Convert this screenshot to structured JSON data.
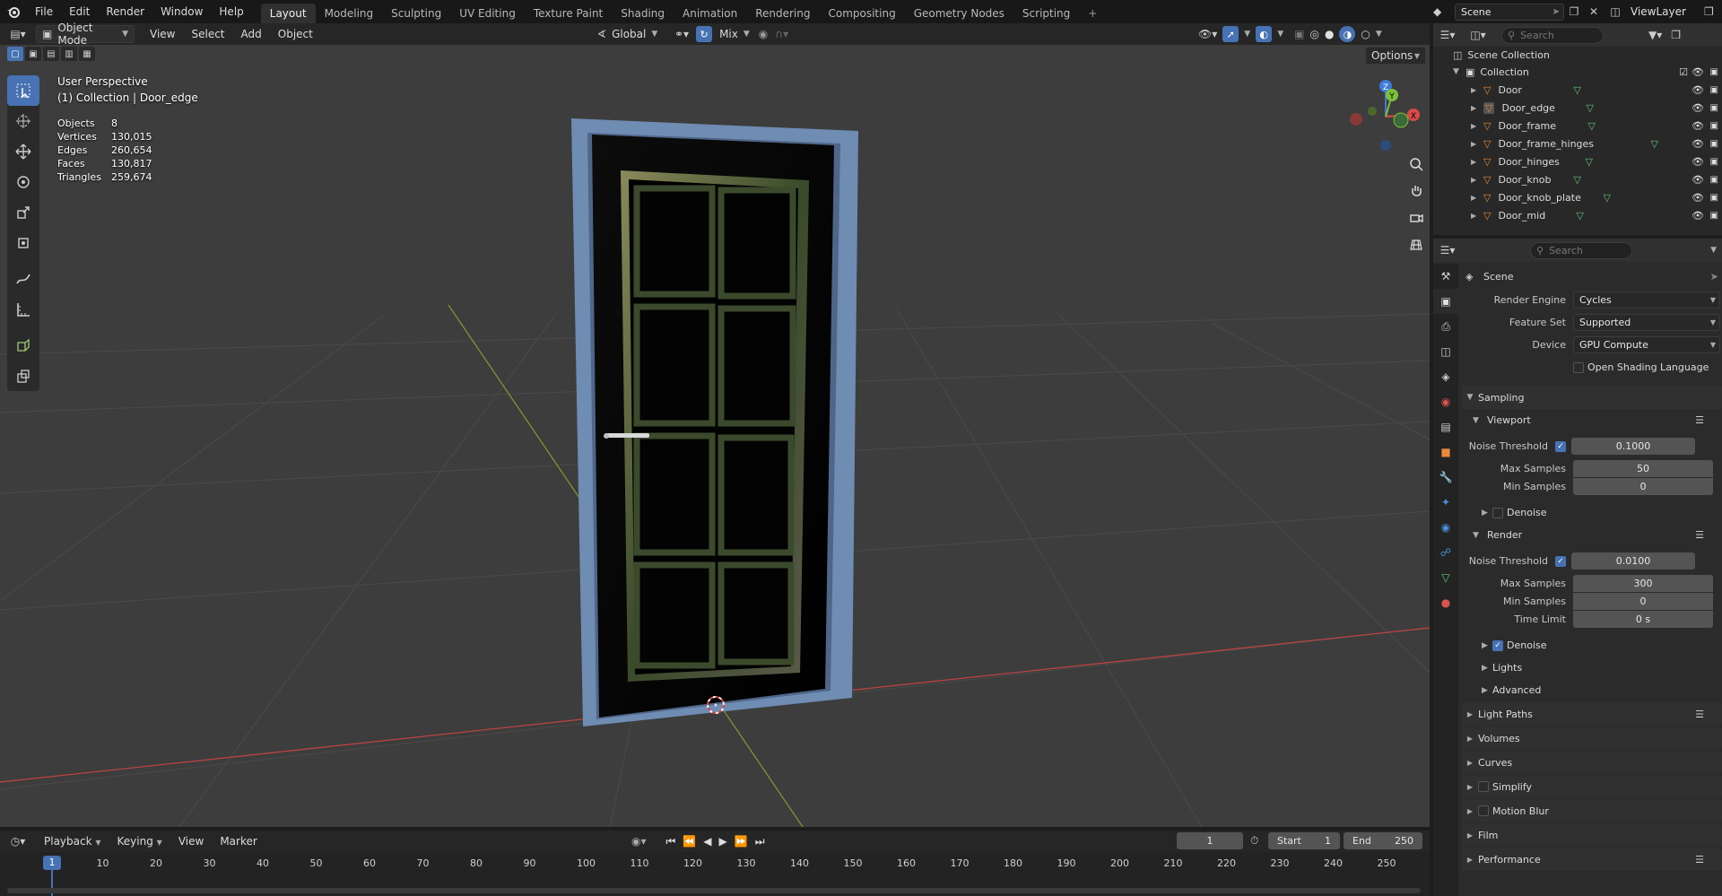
{
  "app": {
    "menu": [
      "File",
      "Edit",
      "Render",
      "Window",
      "Help"
    ],
    "workspaces": [
      "Layout",
      "Modeling",
      "Sculpting",
      "UV Editing",
      "Texture Paint",
      "Shading",
      "Animation",
      "Rendering",
      "Compositing",
      "Geometry Nodes",
      "Scripting"
    ],
    "active_workspace": "Layout",
    "add_tab": "+",
    "scene_name": "Scene",
    "view_layer": "ViewLayer"
  },
  "viewport_header": {
    "mode": "Object Mode",
    "menus": [
      "View",
      "Select",
      "Add",
      "Object"
    ],
    "orientation": "Global",
    "proportional": "Mix",
    "options": "Options"
  },
  "viewport": {
    "perspective": "User Perspective",
    "context": "(1) Collection | Door_edge",
    "stats": [
      {
        "label": "Objects",
        "value": "8"
      },
      {
        "label": "Vertices",
        "value": "130,015"
      },
      {
        "label": "Edges",
        "value": "260,654"
      },
      {
        "label": "Faces",
        "value": "130,817"
      },
      {
        "label": "Triangles",
        "value": "259,674"
      }
    ],
    "gizmo": {
      "z": "Z",
      "y": "Y",
      "x": "X"
    }
  },
  "outliner": {
    "search_placeholder": "Search",
    "root": "Scene Collection",
    "collection": "Collection",
    "objects": [
      "Door",
      "Door_edge",
      "Door_frame",
      "Door_frame_hinges",
      "Door_hinges",
      "Door_knob",
      "Door_knob_plate",
      "Door_mid"
    ],
    "selected": "Door_edge"
  },
  "properties": {
    "search_placeholder": "Search",
    "context": "Scene",
    "render_engine": {
      "label": "Render Engine",
      "value": "Cycles"
    },
    "feature_set": {
      "label": "Feature Set",
      "value": "Supported"
    },
    "device": {
      "label": "Device",
      "value": "GPU Compute"
    },
    "osl": "Open Shading Language",
    "sampling": "Sampling",
    "viewport": {
      "title": "Viewport",
      "noise_threshold": {
        "label": "Noise Threshold",
        "value": "0.1000"
      },
      "max_samples": {
        "label": "Max Samples",
        "value": "50"
      },
      "min_samples": {
        "label": "Min Samples",
        "value": "0"
      },
      "denoise": "Denoise"
    },
    "render": {
      "title": "Render",
      "noise_threshold": {
        "label": "Noise Threshold",
        "value": "0.0100"
      },
      "max_samples": {
        "label": "Max Samples",
        "value": "300"
      },
      "min_samples": {
        "label": "Min Samples",
        "value": "0"
      },
      "time_limit": {
        "label": "Time Limit",
        "value": "0 s"
      },
      "denoise": "Denoise"
    },
    "subsections": [
      "Lights",
      "Advanced"
    ],
    "panels": [
      "Light Paths",
      "Volumes",
      "Curves",
      "Simplify",
      "Motion Blur",
      "Film",
      "Performance"
    ]
  },
  "timeline": {
    "menus": [
      "Playback",
      "Keying",
      "View",
      "Marker"
    ],
    "current_frame": "1",
    "start_label": "Start",
    "start": "1",
    "end_label": "End",
    "end": "250",
    "ticks": [
      "10",
      "20",
      "30",
      "40",
      "50",
      "60",
      "70",
      "80",
      "90",
      "100",
      "110",
      "120",
      "130",
      "140",
      "150",
      "160",
      "170",
      "180",
      "190",
      "200",
      "210",
      "220",
      "230",
      "240",
      "250"
    ],
    "playhead": "1"
  },
  "colors": {
    "accent": "#4772b3",
    "object_orange": "#e8893a",
    "mesh_green": "#5fc67c",
    "axis_red": "#c24343",
    "axis_green": "#7f9e2e"
  }
}
